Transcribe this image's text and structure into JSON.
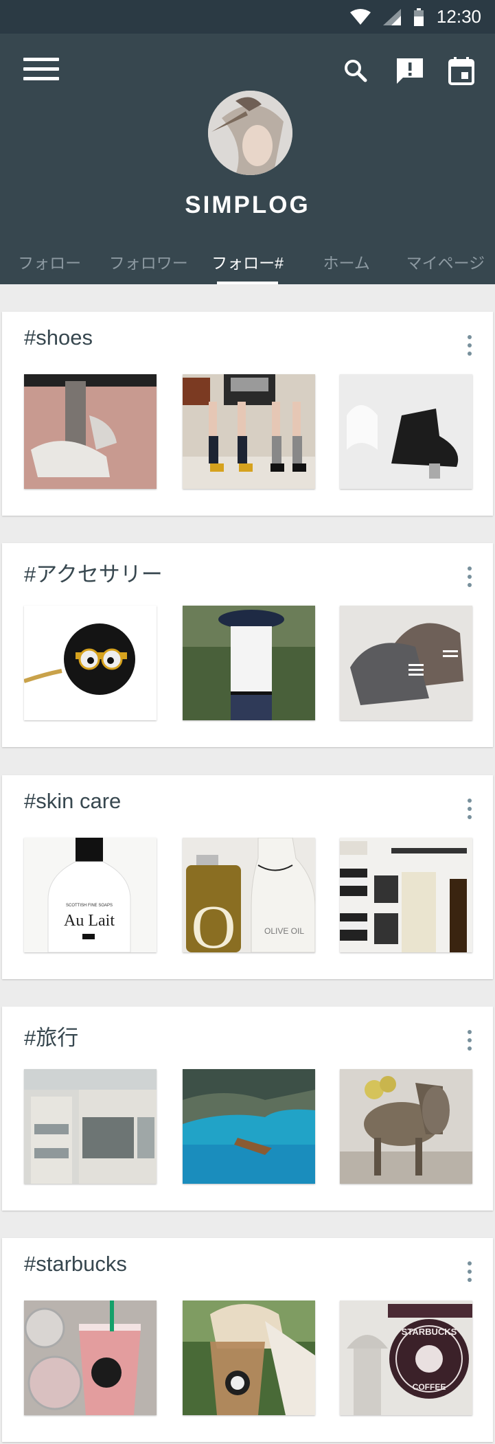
{
  "status_bar": {
    "time": "12:30"
  },
  "app": {
    "title": "SIMPLOG"
  },
  "tabs": [
    {
      "label": "フォロー"
    },
    {
      "label": "フォロワー"
    },
    {
      "label": "フォロー#"
    },
    {
      "label": "ホーム"
    },
    {
      "label": "マイページ"
    }
  ],
  "active_tab": "フォロー#",
  "cards": [
    {
      "tag": "#shoes"
    },
    {
      "tag": "#アクセサリー"
    },
    {
      "tag": "#skin care",
      "photo_text": {
        "brand": "SCOTTISH FINE SOAPS",
        "product": "Au Lait",
        "bottle_letter": "O",
        "bottle_label": "OLIVE OIL"
      }
    },
    {
      "tag": "#旅行"
    },
    {
      "tag": "#starbucks",
      "photo_text": {
        "sign": "STARBUCKS",
        "sign_sub": "COFFEE"
      }
    }
  ],
  "colors": {
    "header": "#37474f",
    "status_bar": "#2b3a44",
    "background": "#ececec",
    "title_text": "#37474f",
    "tab_inactive": "#8d9aa2"
  },
  "icons": [
    "menu-icon",
    "search-icon",
    "report-icon",
    "calendar-icon",
    "wifi-icon",
    "signal-icon",
    "battery-icon",
    "more-vert-icon"
  ]
}
